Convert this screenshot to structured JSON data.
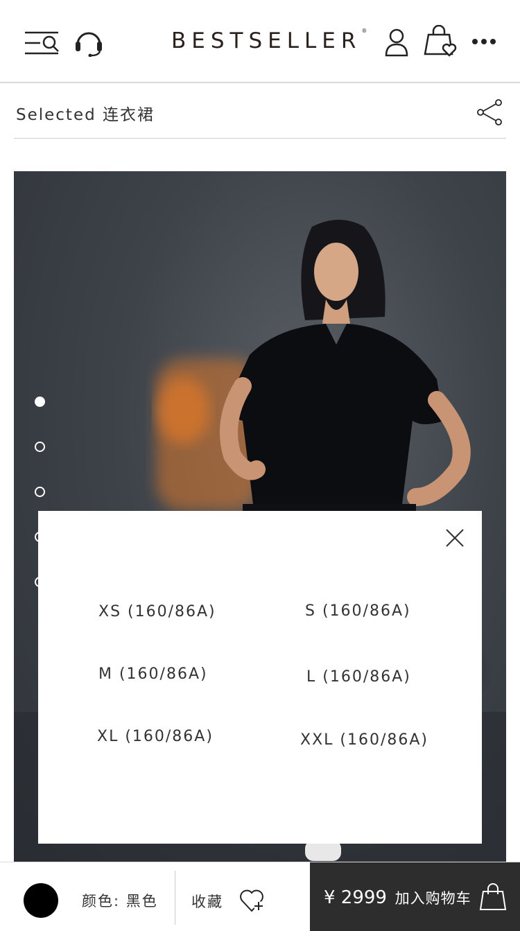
{
  "header": {
    "brand": "BESTSELLER",
    "brand_mark": "®",
    "icons": [
      "menu-search-icon",
      "headset-icon",
      "user-icon",
      "shopping-bag-heart-icon",
      "more-icon"
    ]
  },
  "breadcrumb": {
    "text": "Selected 连衣裙",
    "share_icon": "share-icon"
  },
  "gallery": {
    "dots": 5,
    "active_dot": 1
  },
  "size_modal": {
    "close_icon": "close-icon",
    "sizes": [
      "XS (160/86A)",
      "S (160/86A)",
      "M (160/86A)",
      "L (160/86A)",
      "XL (160/86A)",
      "XXL (160/86A)"
    ]
  },
  "bottom_bar": {
    "color_label": "颜色: 黑色",
    "swatch_color": "#000000",
    "favorite_label": "收藏",
    "price": "¥ 2999",
    "add_to_cart": "加入购物车"
  },
  "colors": {
    "cart_button": "#2d2d2d",
    "text": "#333333"
  }
}
